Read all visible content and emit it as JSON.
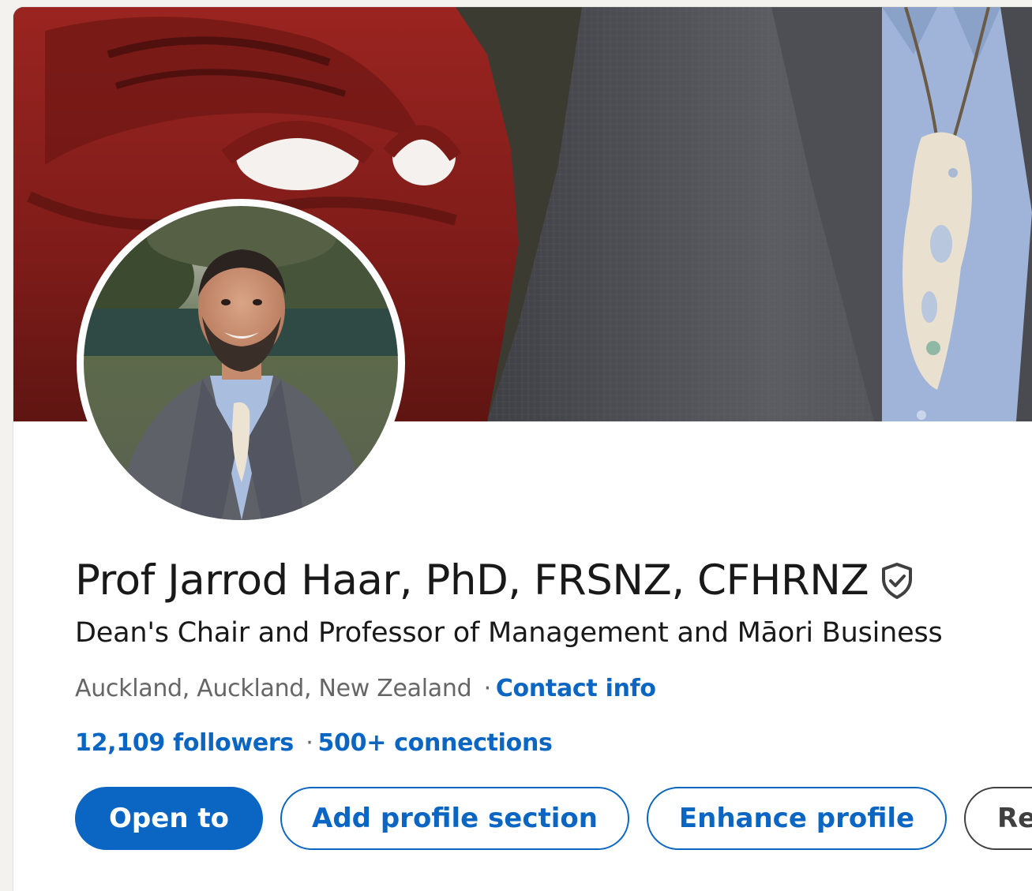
{
  "profile": {
    "name": "Prof Jarrod Haar, PhD, FRSNZ, CFHRNZ",
    "headline": "Dean's Chair and Professor of Management and Māori Business",
    "location": "Auckland, Auckland, New Zealand",
    "location_separator": "·",
    "contact_info_label": "Contact info",
    "followers": "12,109 followers",
    "stats_separator": "·",
    "connections": "500+ connections"
  },
  "actions": {
    "open_to_label": "Open to",
    "add_section_label": "Add profile section",
    "enhance_label": "Enhance profile",
    "resources_label": "Res"
  },
  "icons": {
    "verified": "verified-shield-icon"
  },
  "colors": {
    "accent": "#0a66c2",
    "text_primary": "#191919",
    "text_secondary": "#666666",
    "banner_red": "#8c1f1c",
    "suit_gray": "#57585d",
    "shirt_blue": "#9fb4d8",
    "pendant_bone": "#e9e0cf"
  }
}
